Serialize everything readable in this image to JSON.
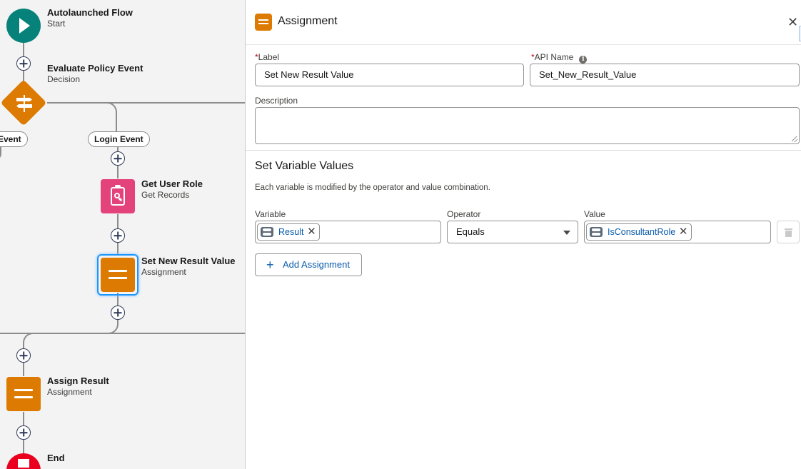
{
  "canvas": {
    "start_node": {
      "title": "Autolaunched Flow",
      "subtitle": "Start",
      "color": "#06827a"
    },
    "decision_node": {
      "title": "Evaluate Policy Event",
      "subtitle": "Decision",
      "color": "#dd7a01"
    },
    "branches": {
      "left_label": "Event",
      "right_label": "Login Event"
    },
    "get_records_node": {
      "title": "Get User Role",
      "subtitle": "Get Records",
      "color": "#e3427b"
    },
    "selected_node": {
      "title": "Set New Result Value",
      "subtitle": "Assignment",
      "color": "#dd7a01"
    },
    "assign_node": {
      "title": "Assign Result",
      "subtitle": "Assignment",
      "color": "#dd7a01"
    },
    "end_node": {
      "title": "End",
      "color": "#ea001e"
    }
  },
  "panel": {
    "title": "Assignment",
    "close_icon": "close-icon",
    "label_field": {
      "label": "Label",
      "value": "Set New Result Value"
    },
    "api_name_field": {
      "label": "API Name",
      "value": "Set_New_Result_Value"
    },
    "description_field": {
      "label": "Description",
      "value": ""
    },
    "section_title": "Set Variable Values",
    "section_help": "Each variable is modified by the operator and value combination.",
    "columns": {
      "variable": "Variable",
      "operator": "Operator",
      "value": "Value"
    },
    "row": {
      "variable": "Result",
      "operator": "Equals",
      "value": "IsConsultantRole"
    },
    "add_button": "Add Assignment",
    "accent_color": "#0b5cab"
  }
}
